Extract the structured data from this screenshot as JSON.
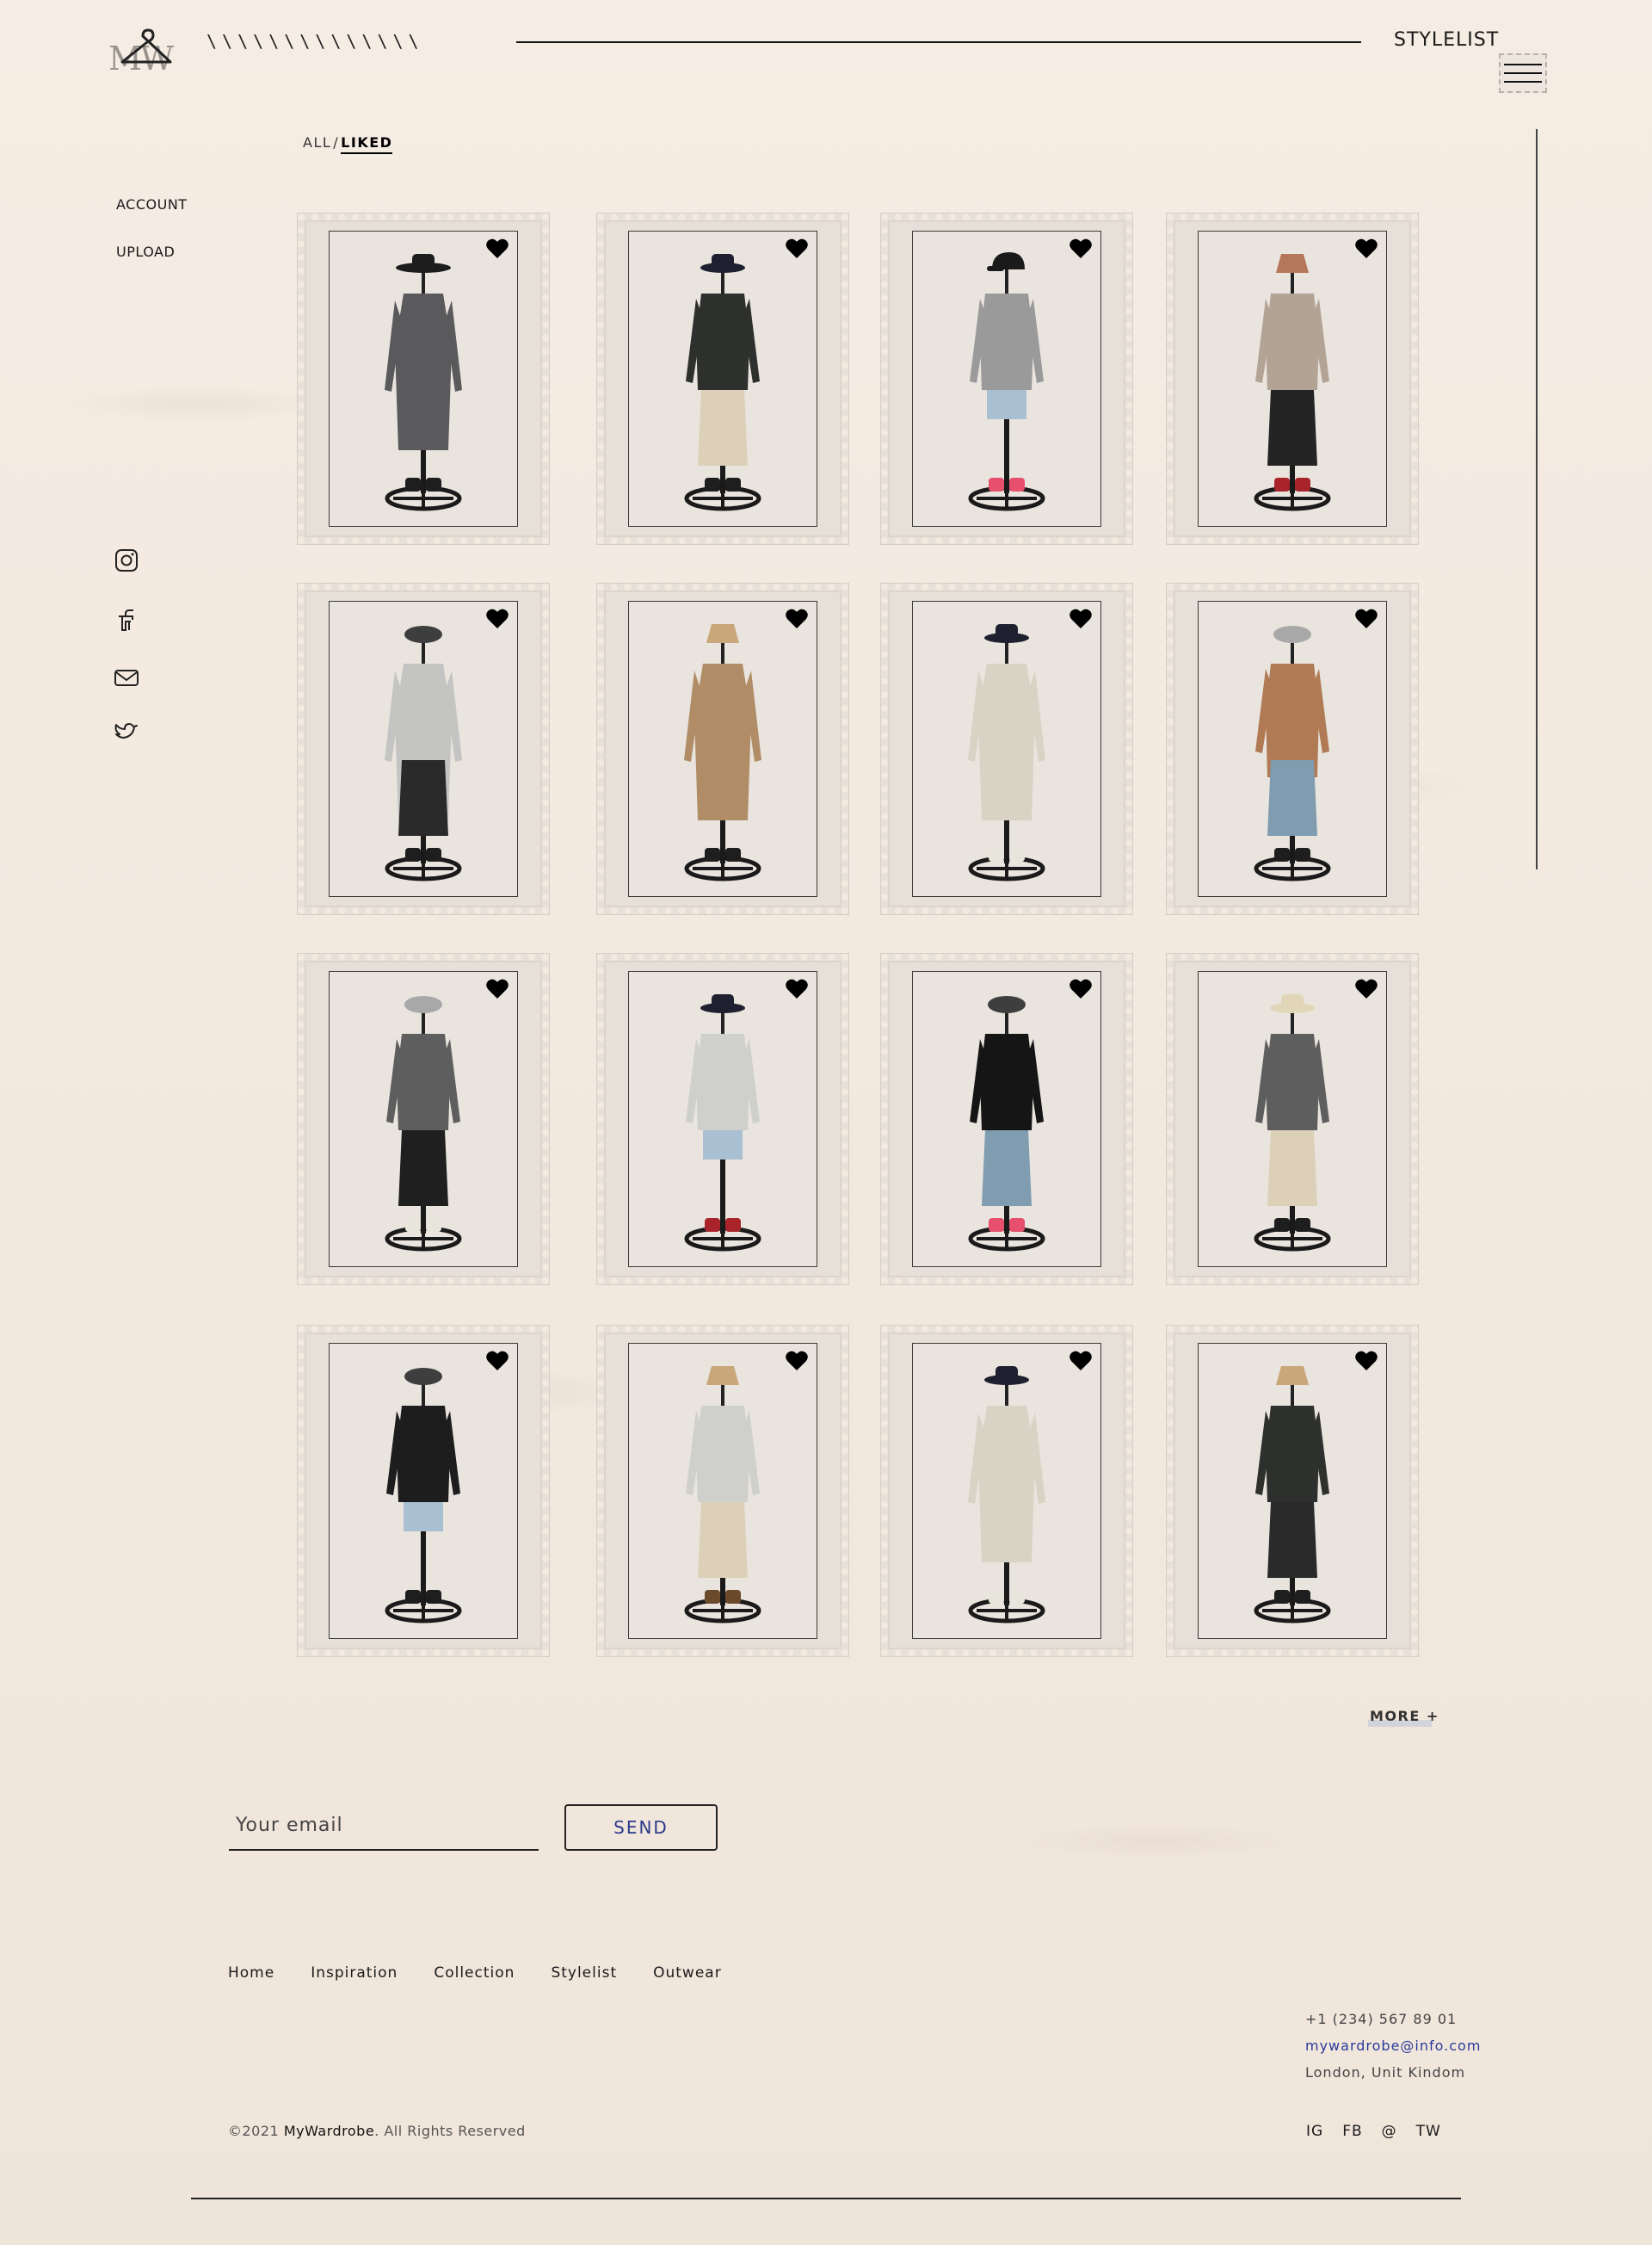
{
  "header": {
    "logo_letters": "MW",
    "slashes": "\\\\\\\\\\\\\\\\\\\\\\\\\\\\",
    "site_label": "STYLELIST"
  },
  "filters": {
    "all": "ALL",
    "separator": "/",
    "liked": "LIKED"
  },
  "left_nav": {
    "account": "ACCOUNT",
    "upload": "UPLOAD"
  },
  "social_icons": [
    "instagram-icon",
    "facebook-icon",
    "mail-icon",
    "twitter-icon"
  ],
  "outfits": [
    {
      "hat": "wide",
      "top": "coat-grey",
      "bottom": "none",
      "shoes": "dark",
      "liked": true
    },
    {
      "hat": "fedora",
      "top": "jacket-dark",
      "bottom": "culottes-beige",
      "shoes": "dark",
      "liked": true
    },
    {
      "hat": "cap",
      "top": "sweater-grey",
      "bottom": "shorts-denim",
      "shoes": "pink",
      "liked": true
    },
    {
      "hat": "bucket-check",
      "top": "blazer-taupe",
      "bottom": "skirt-black",
      "shoes": "red",
      "liked": true
    },
    {
      "hat": "beret-dark",
      "top": "coat-lightgrey",
      "bottom": "skirt-leather",
      "shoes": "dark",
      "liked": true
    },
    {
      "hat": "bucket-beige",
      "top": "poncho-check",
      "bottom": "none",
      "shoes": "dark",
      "liked": true
    },
    {
      "hat": "fedora",
      "top": "trench-cream",
      "bottom": "none",
      "shoes": "white",
      "liked": true
    },
    {
      "hat": "beret-grey",
      "top": "shirt-plaid",
      "bottom": "skirt-denim",
      "shoes": "dark",
      "liked": true
    },
    {
      "hat": "beret-grey",
      "top": "tee-knit",
      "bottom": "skirt-fringe",
      "shoes": "white",
      "liked": true
    },
    {
      "hat": "fedora",
      "top": "sweater-light",
      "bottom": "shorts-denim",
      "shoes": "red",
      "liked": true
    },
    {
      "hat": "beret-dark",
      "top": "turtleneck-black",
      "bottom": "skirt-denim",
      "shoes": "pink",
      "liked": true
    },
    {
      "hat": "boater",
      "top": "tee-knit",
      "bottom": "culottes-beige",
      "shoes": "dark",
      "liked": true
    },
    {
      "hat": "beret-dark",
      "top": "blazer-leather",
      "bottom": "shorts-denim",
      "shoes": "dark",
      "liked": true
    },
    {
      "hat": "bucket-beige",
      "top": "sweater-light",
      "bottom": "culottes-beige",
      "shoes": "brown",
      "liked": true
    },
    {
      "hat": "fedora",
      "top": "trench-cream",
      "bottom": "none",
      "shoes": "white",
      "liked": true
    },
    {
      "hat": "bucket-beige",
      "top": "jacket-dark",
      "bottom": "skirt-leather",
      "shoes": "dark",
      "liked": true
    }
  ],
  "more_label": "MORE +",
  "newsletter": {
    "placeholder": "Your email",
    "send_label": "SEND"
  },
  "footer": {
    "nav": [
      "Home",
      "Inspiration",
      "Collection",
      "Stylelist",
      "Outwear"
    ],
    "phone": "+1 (234) 567 89 01",
    "email": "mywardrobe@info.com",
    "address": "London, Unit Kindom",
    "copyright_prefix": "©2021 ",
    "copyright_brand": "MyWardrobe",
    "copyright_suffix": ". All Rights Reserved",
    "social": [
      "IG",
      "FB",
      "@",
      "TW"
    ]
  },
  "colors": {
    "background": "#f3e9df",
    "stamp": "#e6e0d9",
    "accent_blue": "#2a3a8a"
  }
}
